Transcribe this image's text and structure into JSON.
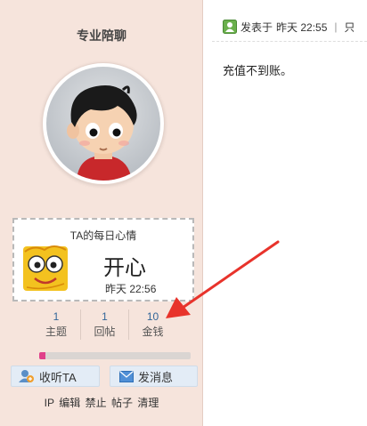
{
  "profile": {
    "username": "专业陪聊",
    "avatar": "cartoon-boy-avatar"
  },
  "mood": {
    "title": "TA的每日心情",
    "text": "开心",
    "time": "昨天 22:56",
    "icon": "yellow-smiley-face"
  },
  "stats": [
    {
      "num": "1",
      "label": "主题"
    },
    {
      "num": "1",
      "label": "回帖"
    },
    {
      "num": "10",
      "label": "金钱"
    }
  ],
  "level_progress": 0.04,
  "buttons": {
    "follow": "收听TA",
    "message": "发消息"
  },
  "admin_links": [
    "IP",
    "编辑",
    "禁止",
    "帖子",
    "清理"
  ],
  "post": {
    "posted_label": "发表于",
    "posted_time": "昨天 22:55",
    "more": "只",
    "content": "充值不到账。"
  },
  "colors": {
    "sidebar_bg": "#f6e4dc",
    "progress_fill": "#e0408a",
    "annotation_arrow": "#e8332b"
  }
}
